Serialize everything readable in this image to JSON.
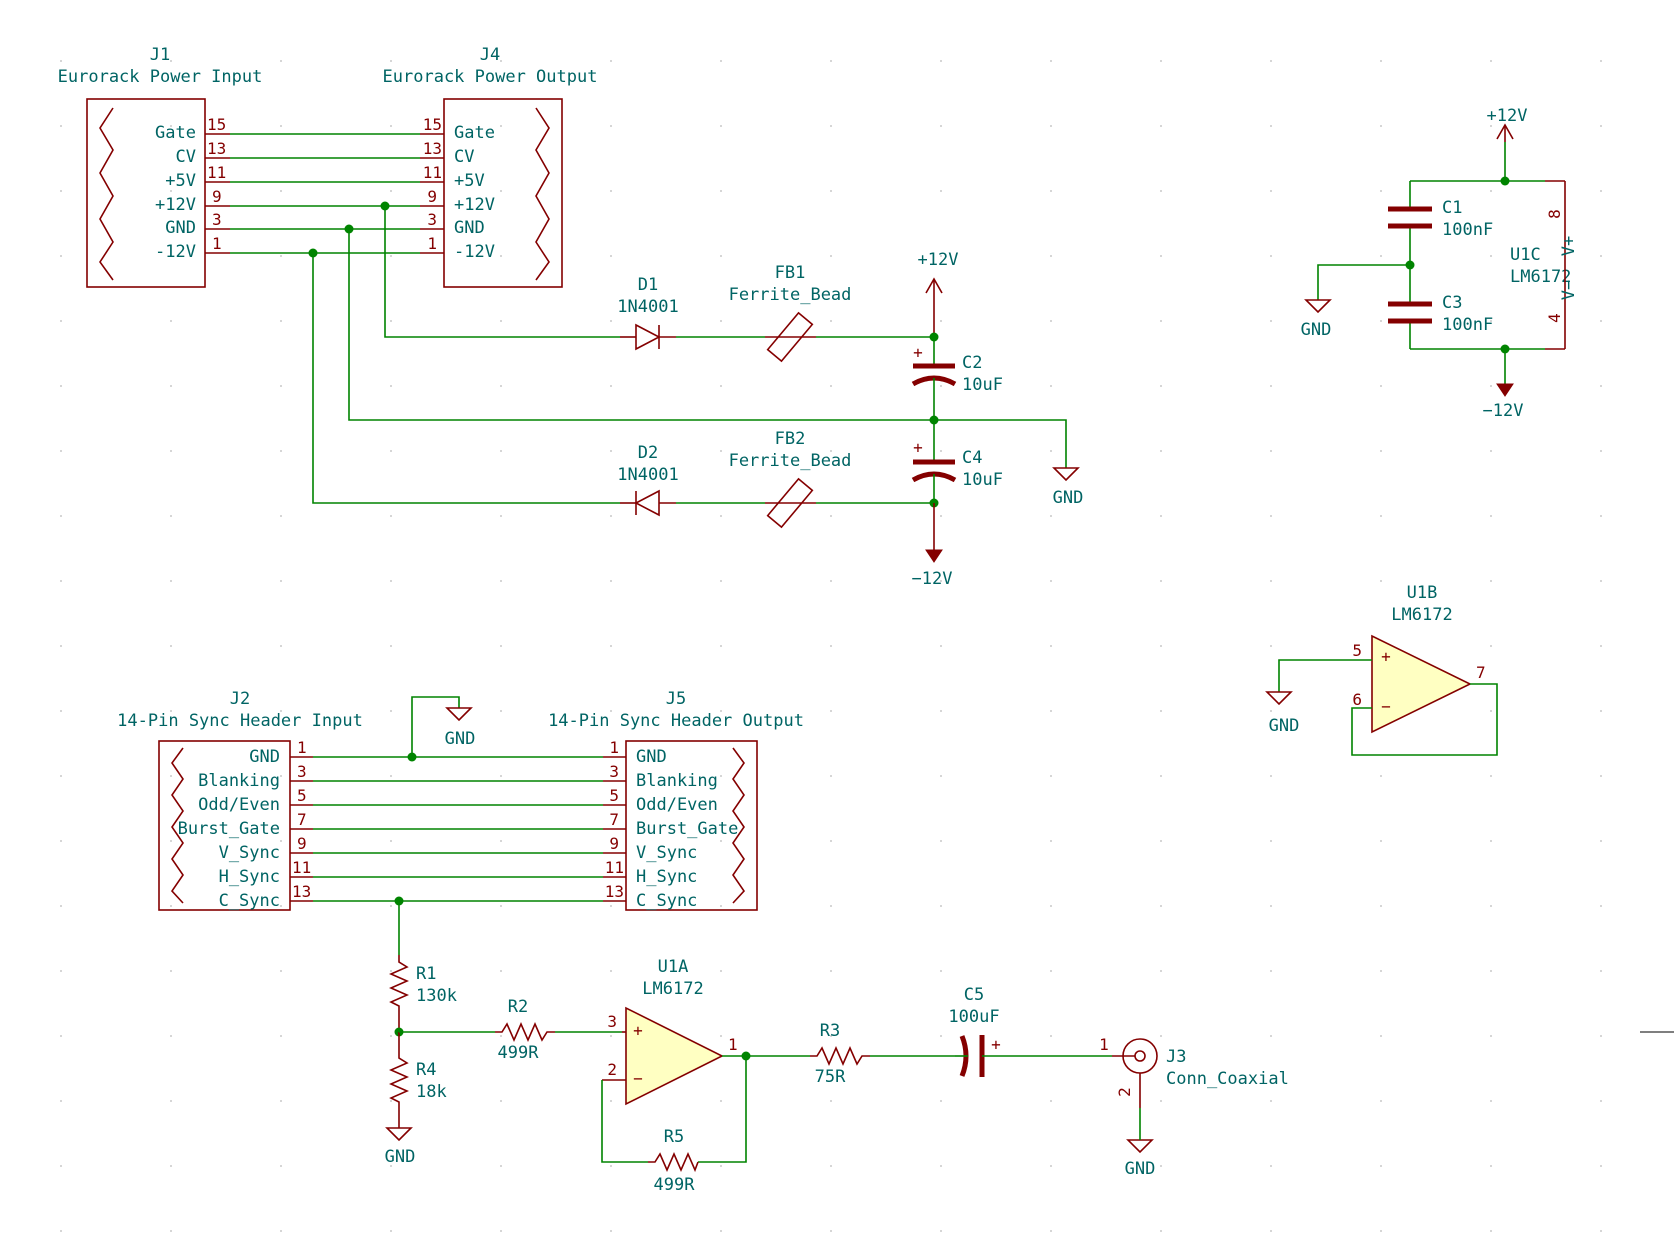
{
  "connectors": {
    "j1": {
      "ref": "J1",
      "value": "Eurorack Power Input",
      "pins": [
        {
          "num": "15",
          "name": "Gate"
        },
        {
          "num": "13",
          "name": "CV"
        },
        {
          "num": "11",
          "name": "+5V"
        },
        {
          "num": "9",
          "name": "+12V"
        },
        {
          "num": "3",
          "name": "GND"
        },
        {
          "num": "1",
          "name": "-12V"
        }
      ]
    },
    "j4": {
      "ref": "J4",
      "value": "Eurorack Power Output",
      "pins": [
        {
          "num": "15",
          "name": "Gate"
        },
        {
          "num": "13",
          "name": "CV"
        },
        {
          "num": "11",
          "name": "+5V"
        },
        {
          "num": "9",
          "name": "+12V"
        },
        {
          "num": "3",
          "name": "GND"
        },
        {
          "num": "1",
          "name": "-12V"
        }
      ]
    },
    "j2": {
      "ref": "J2",
      "value": "14-Pin Sync Header Input",
      "pins": [
        {
          "num": "1",
          "name": "GND"
        },
        {
          "num": "3",
          "name": "Blanking"
        },
        {
          "num": "5",
          "name": "Odd/Even"
        },
        {
          "num": "7",
          "name": "Burst_Gate"
        },
        {
          "num": "9",
          "name": "V_Sync"
        },
        {
          "num": "11",
          "name": "H_Sync"
        },
        {
          "num": "13",
          "name": "C_Sync"
        }
      ]
    },
    "j5": {
      "ref": "J5",
      "value": "14-Pin Sync Header Output",
      "pins": [
        {
          "num": "1",
          "name": "GND"
        },
        {
          "num": "3",
          "name": "Blanking"
        },
        {
          "num": "5",
          "name": "Odd/Even"
        },
        {
          "num": "7",
          "name": "Burst_Gate"
        },
        {
          "num": "9",
          "name": "V_Sync"
        },
        {
          "num": "11",
          "name": "H_Sync"
        },
        {
          "num": "13",
          "name": "C_Sync"
        }
      ]
    },
    "j3": {
      "ref": "J3",
      "value": "Conn_Coaxial",
      "pin1": "1",
      "pin2": "2"
    }
  },
  "components": {
    "d1": {
      "ref": "D1",
      "value": "1N4001"
    },
    "d2": {
      "ref": "D2",
      "value": "1N4001"
    },
    "fb1": {
      "ref": "FB1",
      "value": "Ferrite_Bead"
    },
    "fb2": {
      "ref": "FB2",
      "value": "Ferrite_Bead"
    },
    "c1": {
      "ref": "C1",
      "value": "100nF"
    },
    "c2": {
      "ref": "C2",
      "value": "10uF",
      "polarity": "+"
    },
    "c3": {
      "ref": "C3",
      "value": "100nF"
    },
    "c4": {
      "ref": "C4",
      "value": "10uF",
      "polarity": "+"
    },
    "c5": {
      "ref": "C5",
      "value": "100uF",
      "polarity": "+"
    },
    "r1": {
      "ref": "R1",
      "value": "130k"
    },
    "r2": {
      "ref": "R2",
      "value": "499R"
    },
    "r3": {
      "ref": "R3",
      "value": "75R"
    },
    "r4": {
      "ref": "R4",
      "value": "18k"
    },
    "r5": {
      "ref": "R5",
      "value": "499R"
    },
    "u1a": {
      "ref": "U1A",
      "value": "LM6172",
      "pin_plus": "3",
      "pin_minus": "2",
      "pin_out": "1",
      "sign_plus": "+",
      "sign_minus": "−"
    },
    "u1b": {
      "ref": "U1B",
      "value": "LM6172",
      "pin_plus": "5",
      "pin_minus": "6",
      "pin_out": "7",
      "sign_plus": "+",
      "sign_minus": "−"
    },
    "u1c": {
      "ref": "U1C",
      "value": "LM6172",
      "pin_vp": "8",
      "pin_vm": "4",
      "label_vp": "V+",
      "label_vm": "V−"
    }
  },
  "power": {
    "p12_a": "+12V",
    "p12_b": "+12V",
    "m12_a": "−12V",
    "m12_b": "−12V",
    "gnd": "GND"
  },
  "colors": {
    "wire": "#008400",
    "symbol": "#840000",
    "symbol_fill": "#ffffc2",
    "text": "#006464"
  }
}
